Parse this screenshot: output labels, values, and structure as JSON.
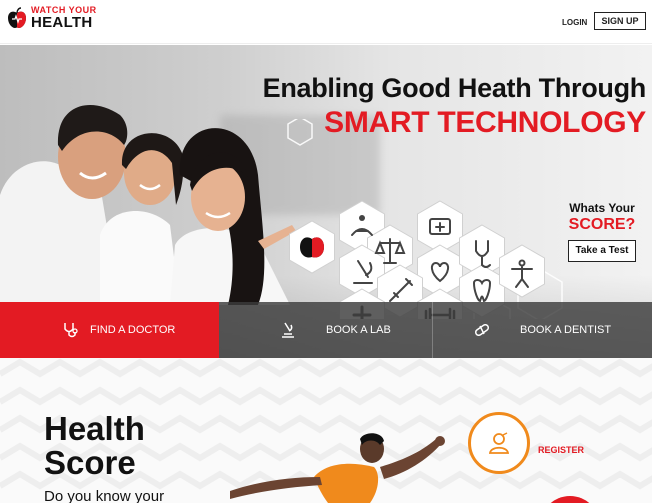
{
  "header": {
    "logo_small": "WATCH YOUR",
    "logo_big": "HEALTH",
    "login_label": "LOGIN",
    "signup_label": "SIGN UP"
  },
  "hero": {
    "title_line1": "Enabling Good Heath Through",
    "title_line2": "SMART TECHNOLOGY",
    "score_question": "Whats Your",
    "score_word": "SCORE?",
    "take_test_label": "Take a Test",
    "hex_icons": [
      "logo-icon",
      "meditation-icon",
      "scale-icon",
      "microscope-icon",
      "first-aid-kit-icon",
      "heart-icon",
      "syringe-icon",
      "stethoscope-icon",
      "tooth-icon",
      "vitruvian-man-icon",
      "plus-icon",
      "dumbbell-icon"
    ]
  },
  "actions": [
    {
      "label": "FIND A DOCTOR",
      "icon": "stethoscope-icon",
      "active": true
    },
    {
      "label": "BOOK A LAB",
      "icon": "microscope-icon",
      "active": false
    },
    {
      "label": "BOOK A DENTIST",
      "icon": "pill-icon",
      "active": false
    }
  ],
  "health_score": {
    "title_line1": "Health",
    "title_line2": "Score",
    "subtitle": "Do you know your",
    "register_label": "REGISTER"
  },
  "colors": {
    "brand_red": "#e31b23",
    "accent_orange": "#f08a1c",
    "bar_gray": "#3c3c3c"
  }
}
